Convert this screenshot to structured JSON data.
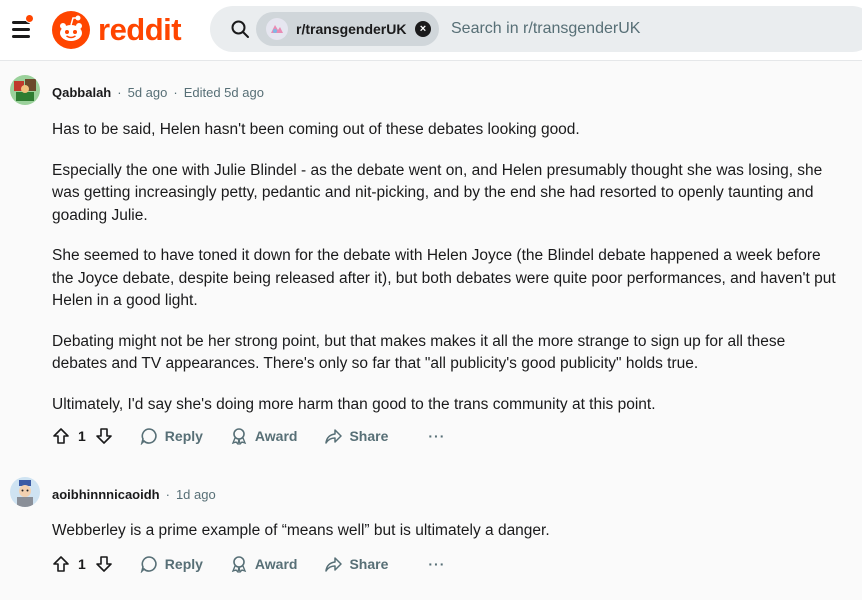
{
  "header": {
    "logo_text": "reddit",
    "search": {
      "community_chip": "r/transgenderUK",
      "placeholder": "Search in r/transgenderUK"
    }
  },
  "comments": [
    {
      "author": "Qabbalah",
      "time": "5d ago",
      "edited": "Edited 5d ago",
      "paragraphs": [
        "Has to be said, Helen hasn't been coming out of these debates looking good.",
        "Especially the one with Julie Blindel - as the debate went on, and Helen presumably thought she was losing, she was getting increasingly petty, pedantic and nit-picking, and by the end she had resorted to openly taunting and goading Julie.",
        "She seemed to have toned it down for the debate with Helen Joyce (the Blindel debate happened a week before the Joyce debate, despite being released after it), but both debates were quite poor performances, and haven't put Helen in a good light.",
        "Debating might not be her strong point, but that makes makes it all the more strange to sign up for all these debates and TV appearances. There's only so far that \"all publicity's good publicity\" holds true.",
        "Ultimately, I'd say she's doing more harm than good to the trans community at this point."
      ],
      "votes": "1",
      "actions": {
        "reply": "Reply",
        "award": "Award",
        "share": "Share",
        "more": "···"
      }
    },
    {
      "author": "aoibhinnnicaoidh",
      "time": "1d ago",
      "paragraphs": [
        "Webberley is a prime example of “means well” but is ultimately a danger."
      ],
      "votes": "1",
      "actions": {
        "reply": "Reply",
        "award": "Award",
        "share": "Share",
        "more": "···"
      }
    }
  ],
  "colors": {
    "brand": "#ff4500",
    "meta_text": "#576f76",
    "search_bg": "#eaedef",
    "chip_bg": "#d0d6da"
  }
}
